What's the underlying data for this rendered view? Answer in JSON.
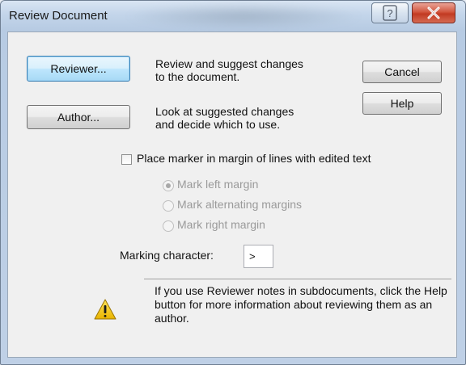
{
  "window": {
    "title": "Review Document",
    "help_caption_glyph": "?",
    "close_caption_glyph": "X"
  },
  "buttons": {
    "reviewer": "Reviewer...",
    "author": "Author...",
    "cancel": "Cancel",
    "help": "Help"
  },
  "descriptions": {
    "reviewer": "Review and suggest changes to the document.",
    "author": "Look at suggested changes and decide which to use."
  },
  "marker": {
    "checkbox_label": "Place marker in margin of lines with edited text",
    "checked": false,
    "options": [
      {
        "label": "Mark left margin",
        "selected": true,
        "enabled": false
      },
      {
        "label": "Mark alternating margins",
        "selected": false,
        "enabled": false
      },
      {
        "label": "Mark right margin",
        "selected": false,
        "enabled": false
      }
    ]
  },
  "marking_character": {
    "label": "Marking character:",
    "value": ">"
  },
  "note": {
    "icon": "warning-icon",
    "text": "If you use Reviewer notes in subdocuments, click the Help button for more information about reviewing them as an author."
  },
  "colors": {
    "titlebar": "#c3d5ea",
    "close_button": "#c23a22",
    "dialog_face": "#f0f0f0",
    "warning": "#f2c200"
  }
}
